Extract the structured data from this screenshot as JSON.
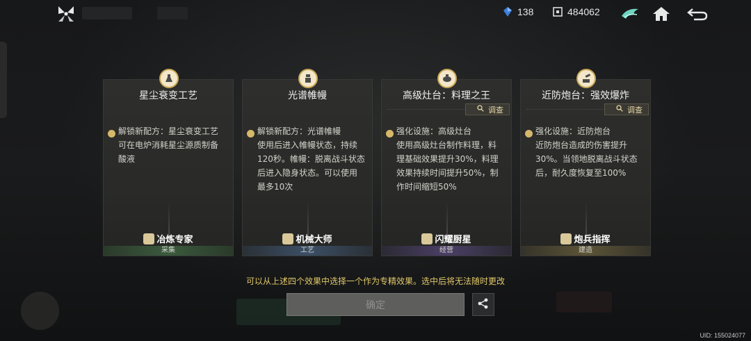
{
  "resources": {
    "crystal": {
      "icon": "blue-crystal-icon",
      "value": "138"
    },
    "credits": {
      "icon": "frame-currency-icon",
      "value": "484062"
    }
  },
  "top_icons": [
    "guild-emblem-icon",
    "home-icon",
    "back-arrow-icon"
  ],
  "cards": [
    {
      "title": "星尘衰变工艺",
      "emblem_icon": "flask-icon",
      "has_survey": false,
      "desc_lines": [
        "解锁新配方：星尘衰变工艺",
        "可在电炉消耗星尘源质制备",
        "酸液"
      ],
      "role": "冶炼专家",
      "category": "采集",
      "category_color": "#3b5a3d"
    },
    {
      "title": "光谱帷幔",
      "emblem_icon": "beacon-icon",
      "has_survey": false,
      "desc_lines": [
        "解锁新配方：光谱帷幔",
        "使用后进入帷幔状态，持续",
        "120秒。帷幔：脱离战斗状态",
        "后进入隐身状态。可以使用",
        "最多10次"
      ],
      "role": "机械大师",
      "category": "工艺",
      "category_color": "#3c4f66"
    },
    {
      "title": "高级灶台：料理之王",
      "emblem_icon": "cooking-pot-icon",
      "has_survey": true,
      "desc_lines": [
        "强化设施：高级灶台",
        "使用高级灶台制作料理，料",
        "理基础效果提升30%，料理",
        "效果持续时间提升50%，制",
        "作时间缩短50%"
      ],
      "role": "闪耀厨星",
      "category": "经营",
      "category_color": "#4a3f66"
    },
    {
      "title": "近防炮台：强效爆炸",
      "emblem_icon": "turret-icon",
      "has_survey": true,
      "desc_lines": [
        "强化设施：近防炮台",
        "近防炮台造成的伤害提升",
        "30%。当领地脱离战斗状态",
        "后，耐久度恢复至100%"
      ],
      "role": "炮兵指挥",
      "category": "建造",
      "category_color": "#5c5436"
    }
  ],
  "survey_label": "调查",
  "notice": "可以从上述四个效果中选择一个作为专精效果。选中后将无法随时更改",
  "confirm_label": "确定",
  "uid": "UID: 155024077"
}
